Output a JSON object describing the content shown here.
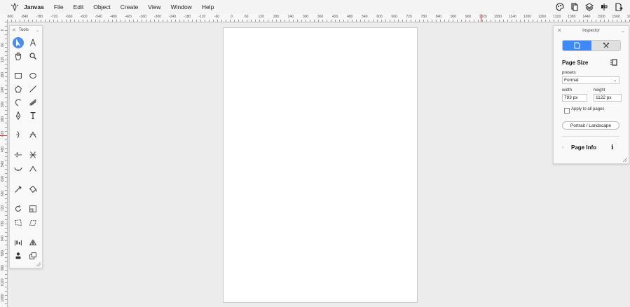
{
  "menubar": {
    "app_name": "Janvas",
    "menus": [
      "File",
      "Edit",
      "Object",
      "Create",
      "View",
      "Window",
      "Help"
    ],
    "right_icons": [
      "palette-icon",
      "pages-icon",
      "layers-icon",
      "align-icon",
      "export-icon"
    ]
  },
  "rulers": {
    "horizontal_labels": [
      "-900",
      "-840",
      "-780",
      "-720",
      "-660",
      "-600",
      "-540",
      "-480",
      "-420",
      "-360",
      "-300",
      "-240",
      "-180",
      "-120",
      "-60",
      "0",
      "60",
      "120",
      "180",
      "240",
      "300",
      "360",
      "420",
      "480",
      "540",
      "600",
      "660",
      "720",
      "780",
      "840",
      "900",
      "960",
      "1020",
      "1080",
      "1140",
      "1200",
      "1260",
      "1320",
      "1380",
      "1440",
      "1500",
      "1560",
      "1620"
    ],
    "vertical_labels": [
      "0",
      "60",
      "120",
      "180",
      "240",
      "300",
      "360",
      "420",
      "480",
      "540",
      "600",
      "660",
      "720",
      "780",
      "840",
      "900",
      "960",
      "1020",
      "1080"
    ]
  },
  "tools_panel": {
    "title": "Tools",
    "tools": [
      {
        "name": "select-tool-icon",
        "active": true
      },
      {
        "name": "direct-select-tool-icon",
        "active": false
      },
      {
        "name": "hand-tool-icon",
        "active": false
      },
      {
        "name": "zoom-tool-icon",
        "active": false
      },
      {
        "name": "rectangle-tool-icon",
        "active": false
      },
      {
        "name": "ellipse-tool-icon",
        "active": false
      },
      {
        "name": "polygon-tool-icon",
        "active": false
      },
      {
        "name": "line-tool-icon",
        "active": false
      },
      {
        "name": "arc-tool-icon",
        "active": false
      },
      {
        "name": "pencil-tool-icon",
        "active": false
      },
      {
        "name": "pen-tool-icon",
        "active": false
      },
      {
        "name": "text-tool-icon",
        "active": false
      },
      {
        "name": "curve-tool-icon",
        "active": false
      },
      {
        "name": "anchor-point-tool-icon",
        "active": false
      },
      {
        "name": "add-point-tool-icon",
        "active": false
      },
      {
        "name": "cut-path-tool-icon",
        "active": false
      },
      {
        "name": "smooth-points-tool-icon",
        "active": false
      },
      {
        "name": "corner-points-tool-icon",
        "active": false
      },
      {
        "name": "eyedropper-tool-icon",
        "active": false
      },
      {
        "name": "paint-bucket-tool-icon",
        "active": false
      },
      {
        "name": "rotate-tool-icon",
        "active": false
      },
      {
        "name": "scale-tool-icon",
        "active": false
      },
      {
        "name": "distort-tool-icon",
        "active": false
      },
      {
        "name": "shear-tool-icon",
        "active": false
      },
      {
        "name": "align-tool-icon",
        "active": false
      },
      {
        "name": "reflect-tool-icon",
        "active": false
      },
      {
        "name": "stamp-tool-icon",
        "active": false
      },
      {
        "name": "clone-tool-icon",
        "active": false
      }
    ]
  },
  "inspector": {
    "title": "Inspector",
    "segments": [
      "document-icon",
      "tools-settings-icon"
    ],
    "page_size_label": "Page Size",
    "presets_label": "presets",
    "preset_value": "Format",
    "width_label": "width",
    "height_label": "height",
    "width_value": "793 px",
    "height_value": "1122 px",
    "apply_all_label": "Apply to all pages",
    "orientation_button": "Portrait / Landscape",
    "page_info_label": "Page Info"
  },
  "colors": {
    "accent": "#3d8af7",
    "ruler_marker": "#e03030",
    "canvas_bg": "#ececec",
    "page_bg": "#ffffff"
  }
}
